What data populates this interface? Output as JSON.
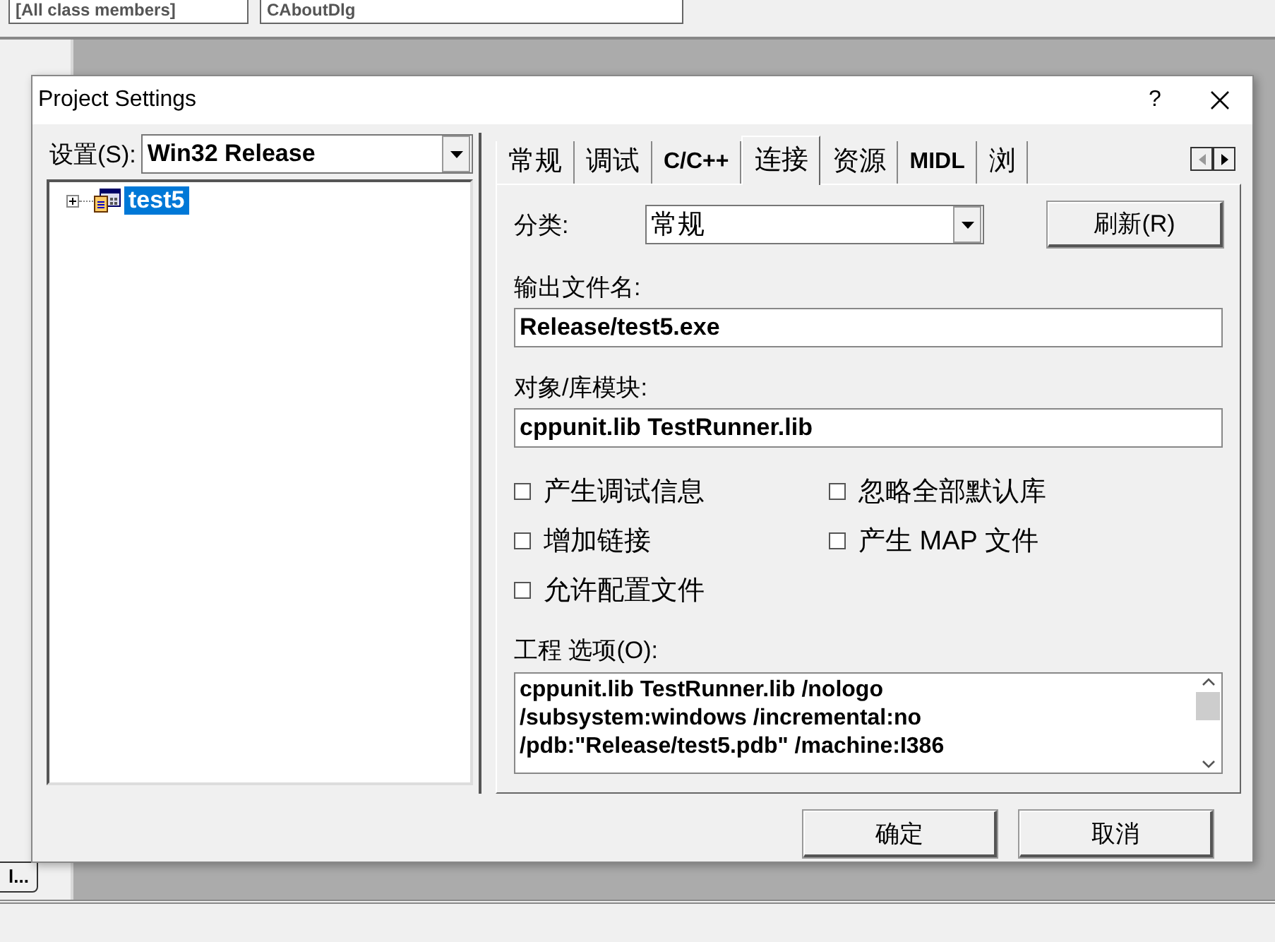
{
  "background": {
    "class_combo": "[All class members]",
    "member_combo": "CAboutDlg",
    "side_button": "l..."
  },
  "window": {
    "title": "Project Settings",
    "help": "?"
  },
  "settings": {
    "label": "设置(S):",
    "value": "Win32 Release"
  },
  "tree": [
    {
      "label": "test5",
      "selected": true,
      "expanded": false
    }
  ],
  "tabs": [
    {
      "label": "常规",
      "selected": false
    },
    {
      "label": "调试",
      "selected": false
    },
    {
      "label": "C/C++",
      "selected": false
    },
    {
      "label": "连接",
      "selected": true
    },
    {
      "label": "资源",
      "selected": false
    },
    {
      "label": "MIDL",
      "selected": false
    },
    {
      "label": "浏",
      "selected": false
    }
  ],
  "category": {
    "label": "分类:",
    "value": "常规"
  },
  "refresh_button": "刷新(R)",
  "output_file": {
    "label": "输出文件名:",
    "value": "Release/test5.exe"
  },
  "modules": {
    "label": "对象/库模块:",
    "value": "cppunit.lib TestRunner.lib"
  },
  "options": [
    {
      "label": "产生调试信息",
      "checked": false
    },
    {
      "label": "忽略全部默认库",
      "checked": false
    },
    {
      "label": "增加链接",
      "checked": false
    },
    {
      "label": "产生 MAP 文件",
      "checked": false
    },
    {
      "label": "允许配置文件",
      "checked": false
    }
  ],
  "project_options": {
    "label": "工程 选项(O):",
    "lines": [
      "cppunit.lib TestRunner.lib /nologo",
      "/subsystem:windows /incremental:no",
      "/pdb:\"Release/test5.pdb\" /machine:I386"
    ]
  },
  "buttons": [
    {
      "label": "确定"
    },
    {
      "label": "取消"
    }
  ]
}
